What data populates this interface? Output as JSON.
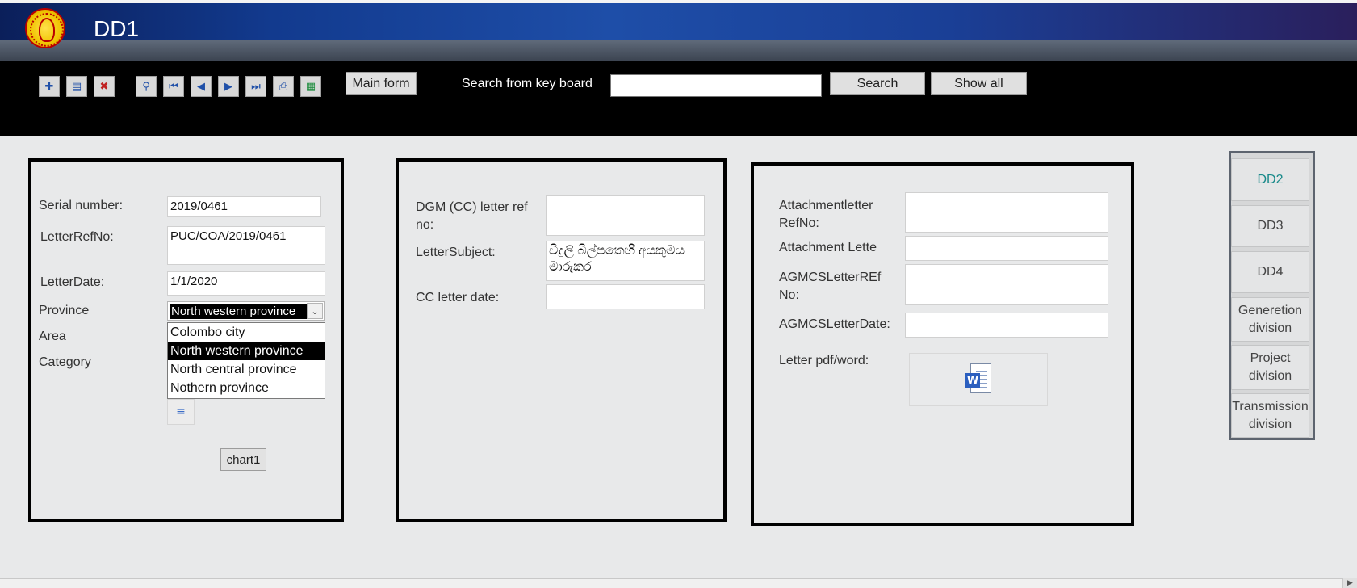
{
  "header": {
    "title": "DD1",
    "logo": "ceb-logo-icon"
  },
  "toolbar": {
    "icon_buttons": [
      {
        "name": "new-record-icon",
        "glyph": "✚"
      },
      {
        "name": "save-record-icon",
        "glyph": "▤"
      },
      {
        "name": "delete-record-icon",
        "glyph": "✖"
      },
      {
        "name": "find-binoculars-icon",
        "glyph": "⚲"
      },
      {
        "name": "first-record-icon",
        "glyph": "⏮"
      },
      {
        "name": "previous-record-icon",
        "glyph": "◀"
      },
      {
        "name": "next-record-icon",
        "glyph": "▶"
      },
      {
        "name": "last-record-icon",
        "glyph": "⏭"
      },
      {
        "name": "print-icon",
        "glyph": "⎙"
      },
      {
        "name": "excel-export-icon",
        "glyph": "▦"
      }
    ],
    "main_form_label": "Main form",
    "search_label": "Search from key board",
    "search_value": "",
    "search_button": "Search",
    "show_all_button": "Show all"
  },
  "left_panel": {
    "serial_label": "Serial number:",
    "serial_value": "2019/0461",
    "ref_label": "LetterRefNo:",
    "ref_value": "PUC/COA/2019/0461",
    "date_label": "LetterDate:",
    "date_value": "1/1/2020",
    "province_label": "Province",
    "province_value": "North western province",
    "area_label": "Area",
    "category_label": "Category",
    "province_options": [
      "Colombo city",
      "North western province",
      "North central province",
      "Nothern province"
    ],
    "selected_option_index": 1,
    "chart_button": "chart1"
  },
  "middle_panel": {
    "dgm_label": "DGM (CC) letter ref no:",
    "dgm_value": "",
    "subject_label": "LetterSubject:",
    "subject_value": "විදුලි බිල්පතෙහි අයකුමය මාරුකර",
    "cc_date_label": "CC letter date:",
    "cc_date_value": ""
  },
  "right_panel": {
    "attach_ref_label": "Attachmentletter RefNo:",
    "attach_ref_value": "",
    "attach_letter_label": "Attachment Lette",
    "attach_letter_value": "",
    "agmcs_ref_label": "AGMCSLetterREf No:",
    "agmcs_ref_value": "",
    "agmcs_date_label": "AGMCSLetterDate:",
    "agmcs_date_value": "",
    "pdf_label": "Letter pdf/word:",
    "doc_icon": "word-document-icon"
  },
  "side_nav": {
    "items": [
      "DD2",
      "DD3",
      "DD4",
      "Generetion division",
      "Project division",
      "Transmission division"
    ],
    "active_index": 0,
    "active_color": "#1a8a8a"
  }
}
